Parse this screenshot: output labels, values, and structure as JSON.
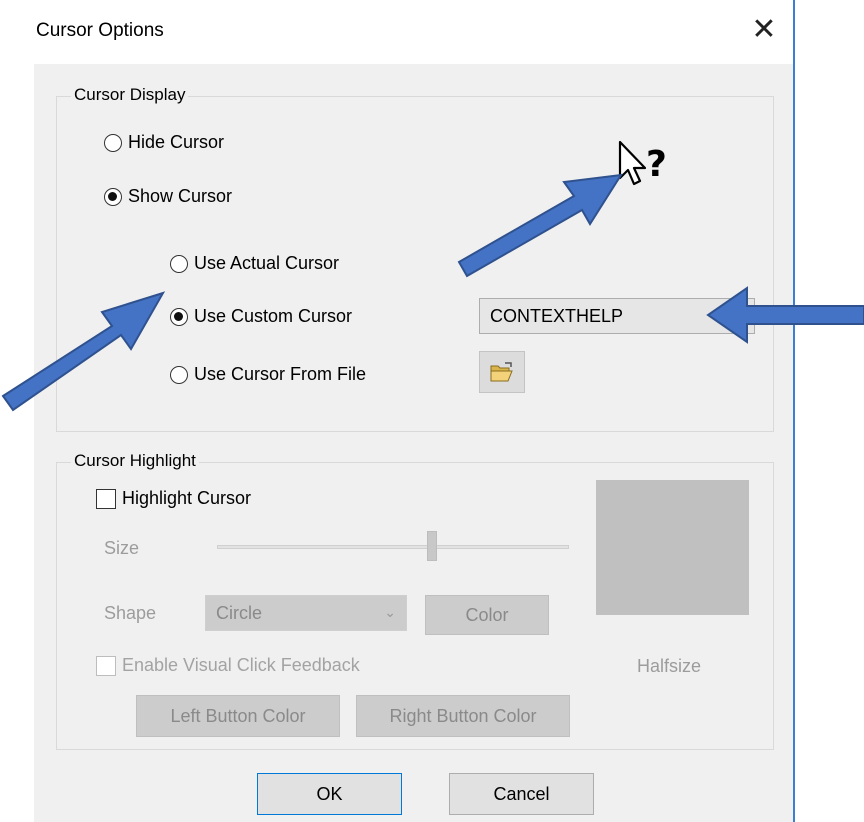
{
  "dialog": {
    "title": "Cursor Options",
    "close_glyph": "✕"
  },
  "cursor_display": {
    "group_label": "Cursor Display",
    "hide_cursor": "Hide Cursor",
    "show_cursor": "Show Cursor",
    "selected_visibility": "Show Cursor",
    "use_actual": "Use Actual Cursor",
    "use_custom": "Use Custom Cursor",
    "use_file": "Use Cursor From File",
    "selected_source": "Use Custom Cursor",
    "custom_cursor_value": "CONTEXTHELP",
    "preview_icon": "context-help-cursor-icon",
    "file_button_icon": "open-folder-icon"
  },
  "cursor_highlight": {
    "group_label": "Cursor Highlight",
    "highlight_cursor": "Highlight Cursor",
    "highlight_checked": false,
    "size_label": "Size",
    "size_slider_level": 0.61,
    "shape_label": "Shape",
    "shape_value": "Circle",
    "color_button": "Color",
    "visual_click": "Enable Visual Click Feedback",
    "halfsize_label": "Halfsize",
    "left_button_color": "Left Button Color",
    "right_button_color": "Right Button Color",
    "preview_color": "#c0c0c0"
  },
  "footer": {
    "ok": "OK",
    "cancel": "Cancel"
  },
  "annotations": {
    "arrow_color": "#4472c4",
    "arrow_outline": "#2f528f"
  }
}
